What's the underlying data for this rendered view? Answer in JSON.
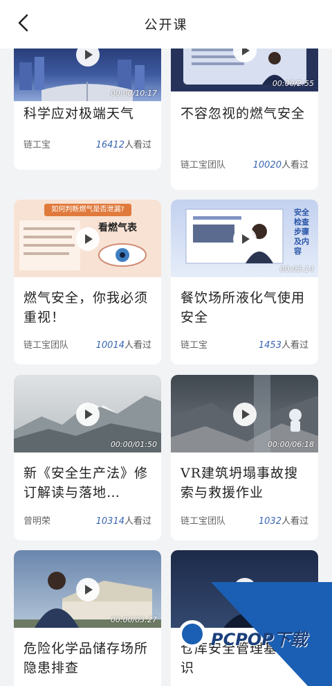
{
  "header": {
    "title": "公开课",
    "back_icon": "chevron-left-icon"
  },
  "courses": [
    {
      "title": "科学应对极端天气",
      "author": "链工宝",
      "views": "16412",
      "views_suffix": "人看过",
      "duration": "00:00/10:17",
      "thumb_colors": [
        "#2d3f7a",
        "#5b74b8"
      ]
    },
    {
      "title": "不容忽视的燃气安全",
      "author": "链工宝团队",
      "views": "10020",
      "views_suffix": "人看过",
      "duration": "00:00/2:55",
      "thumb_colors": [
        "#27345f",
        "#cfd8ea"
      ]
    },
    {
      "title": "燃气安全，你我必须重视！",
      "author": "链工宝团队",
      "views": "10014",
      "views_suffix": "人看过",
      "duration": "",
      "thumb_colors": [
        "#f3d0bd",
        "#fbe9de"
      ],
      "thumb_heading": "如何判断燃气是否泄漏?",
      "thumb_caption": "看燃气表"
    },
    {
      "title": "餐饮场所液化气使用安全",
      "author": "链工宝",
      "views": "1453",
      "views_suffix": "人看过",
      "duration": "00:03:14",
      "thumb_colors": [
        "#b9c9ea",
        "#e4ebf7"
      ],
      "thumb_caption": "安全检查步骤及内容"
    },
    {
      "title": "新《安全生产法》修订解读与落地…",
      "author": "曾明荣",
      "views": "10314",
      "views_suffix": "人看过",
      "duration": "00:00/01:50",
      "thumb_colors": [
        "#cfd3d6",
        "#8f979c"
      ]
    },
    {
      "title": "VR建筑坍塌事故搜索与救援作业",
      "author": "链工宝团队",
      "views": "1032",
      "views_suffix": "人看过",
      "duration": "00:00/06:18",
      "thumb_colors": [
        "#4e5660",
        "#8a8e95"
      ]
    },
    {
      "title": "危险化学品储存场所隐患排查",
      "author": "",
      "views": "",
      "views_suffix": "",
      "duration": "00:00/03:27",
      "thumb_colors": [
        "#5c6f8a",
        "#9db1c8"
      ]
    },
    {
      "title": "仓库安全管理基础知识",
      "author": "",
      "views": "",
      "views_suffix": "",
      "duration": "",
      "thumb_colors": [
        "#1f2f52",
        "#3e5683"
      ]
    }
  ],
  "watermark": {
    "text": "PCPOP下载",
    "color": "#1a5fb4"
  }
}
